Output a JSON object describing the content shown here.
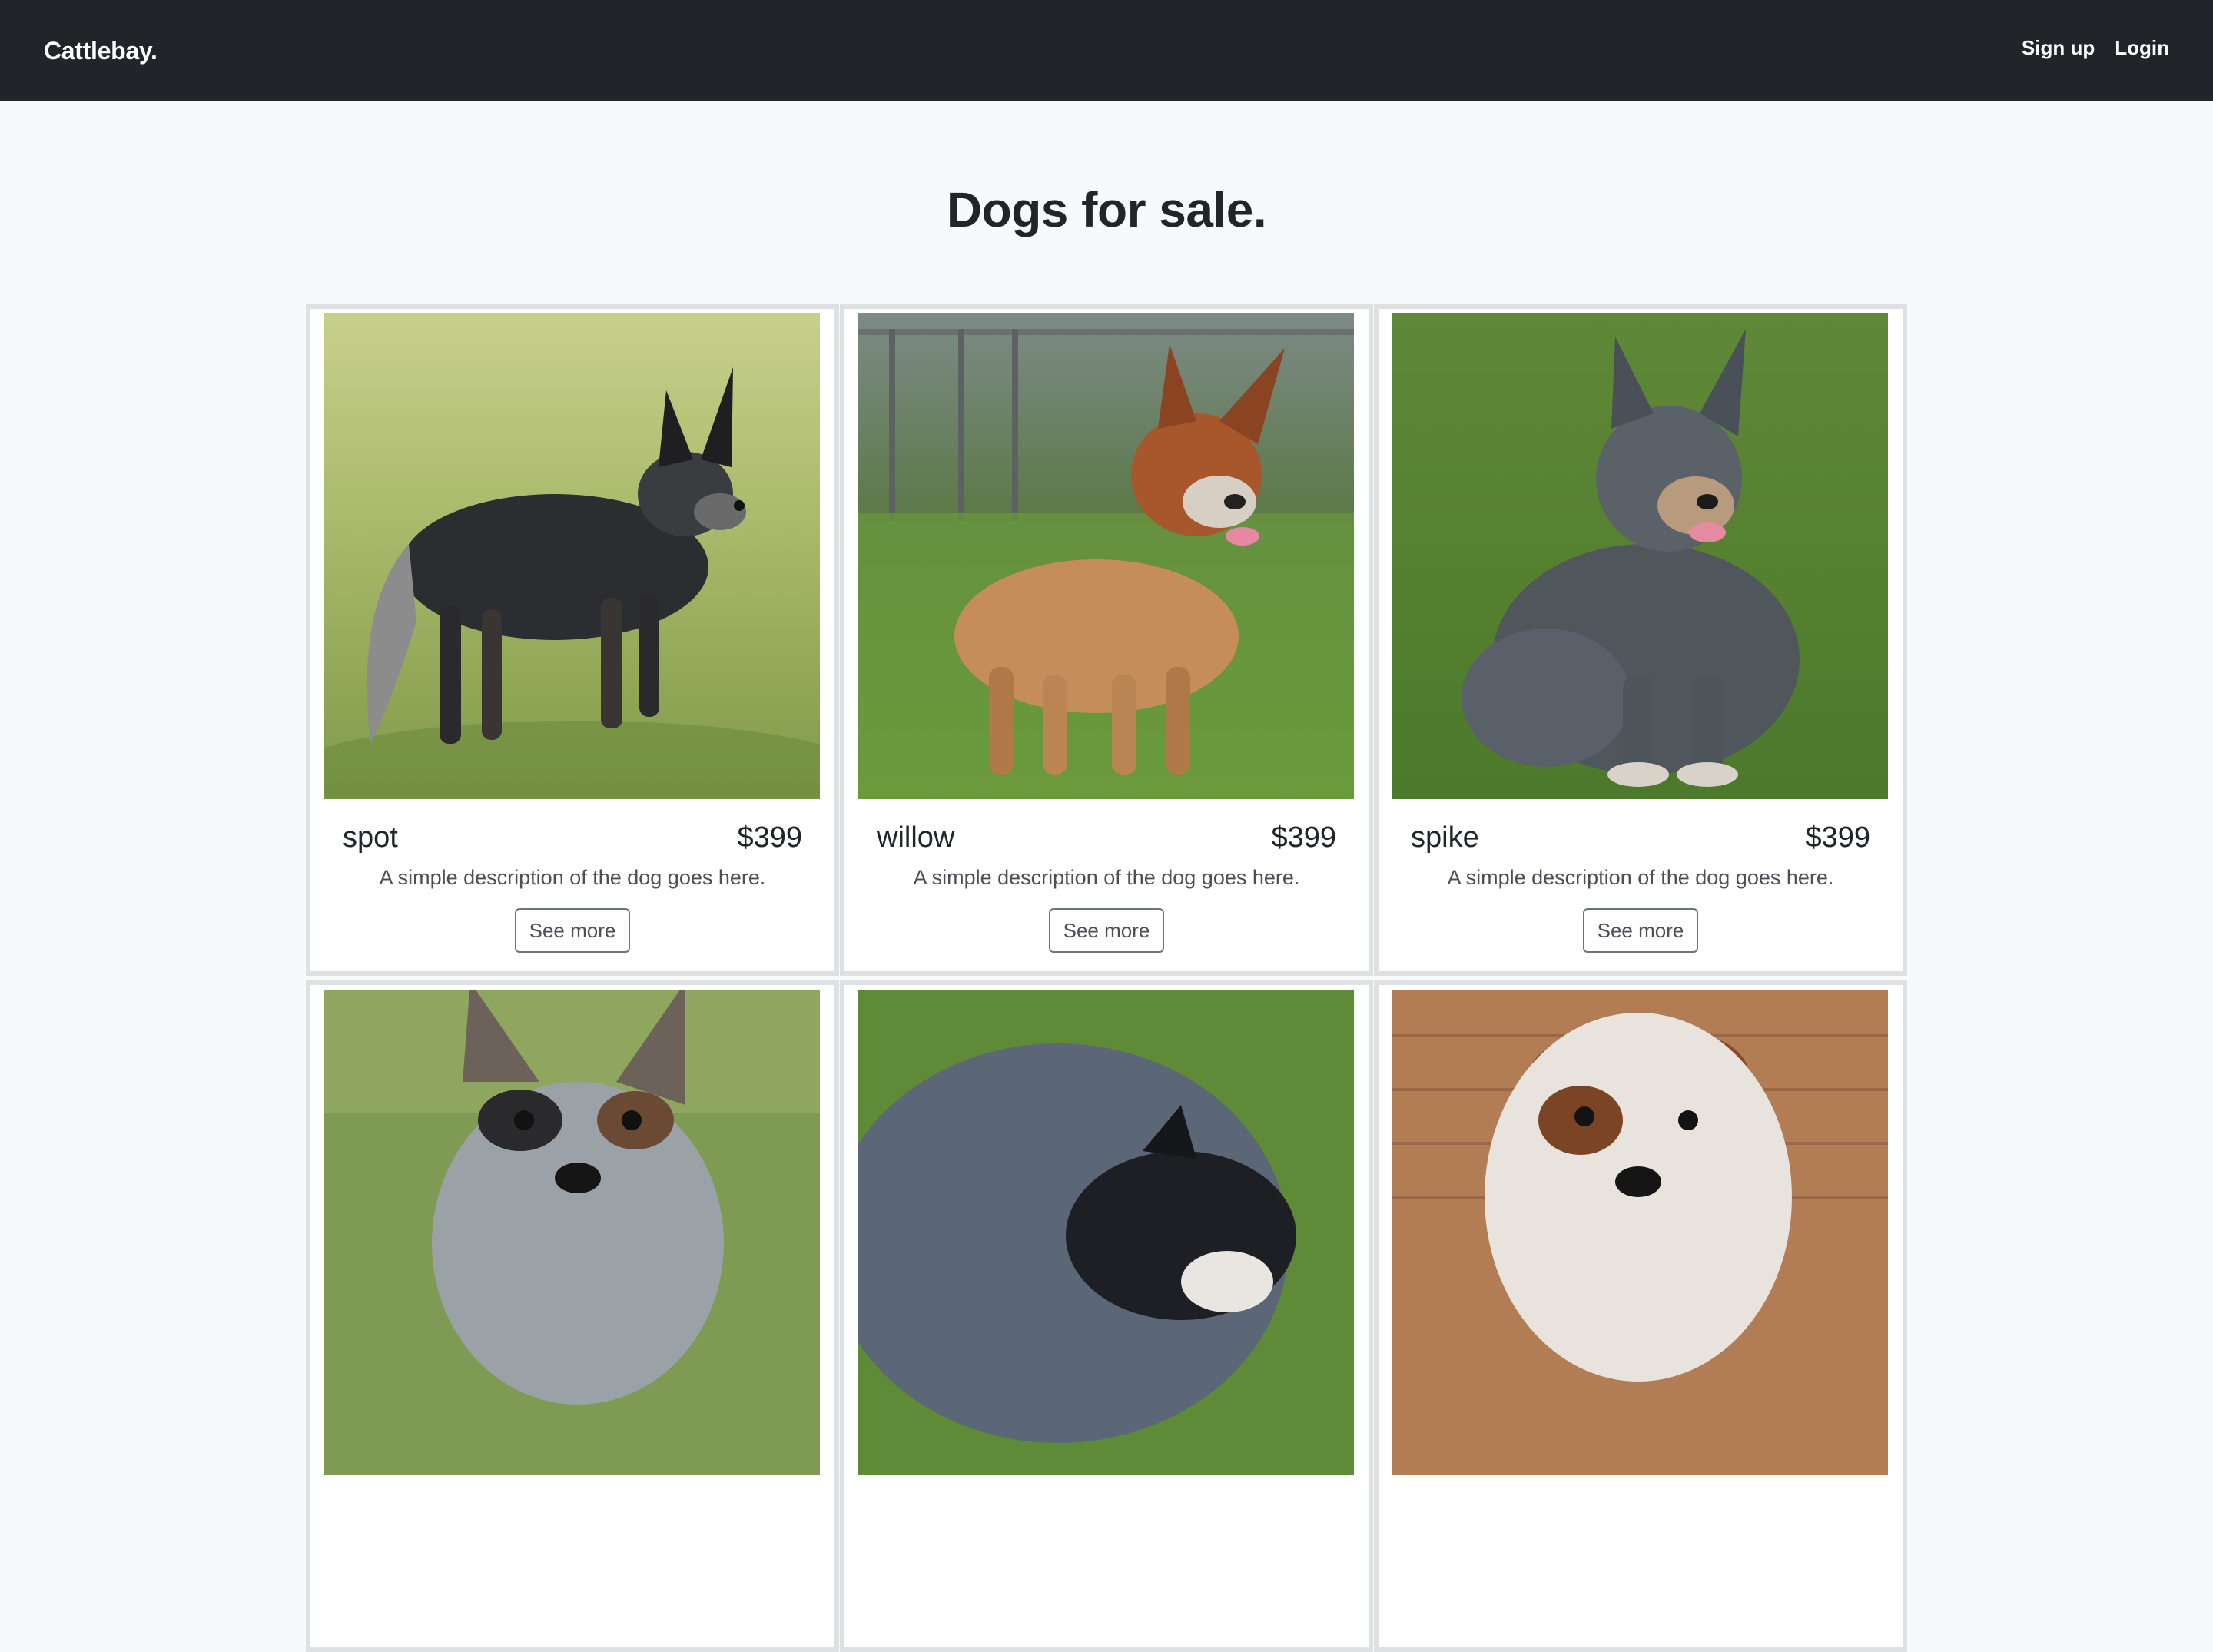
{
  "navbar": {
    "brand": "Cattlebay.",
    "links": [
      {
        "label": "Sign up"
      },
      {
        "label": "Login"
      }
    ]
  },
  "page": {
    "title": "Dogs for sale."
  },
  "dogs": [
    {
      "name": "spot",
      "price": "$399",
      "description": "A simple description of the dog goes here.",
      "button": "See more"
    },
    {
      "name": "willow",
      "price": "$399",
      "description": "A simple description of the dog goes here.",
      "button": "See more"
    },
    {
      "name": "spike",
      "price": "$399",
      "description": "A simple description of the dog goes here.",
      "button": "See more"
    },
    {
      "name": "",
      "price": "",
      "description": "",
      "button": ""
    },
    {
      "name": "",
      "price": "",
      "description": "",
      "button": ""
    },
    {
      "name": "",
      "price": "",
      "description": "",
      "button": ""
    }
  ],
  "colors": {
    "navbar_bg": "#212529",
    "page_bg": "#f8f9fa",
    "card_border": "#dfe0e1",
    "button_border": "#6c757d"
  }
}
